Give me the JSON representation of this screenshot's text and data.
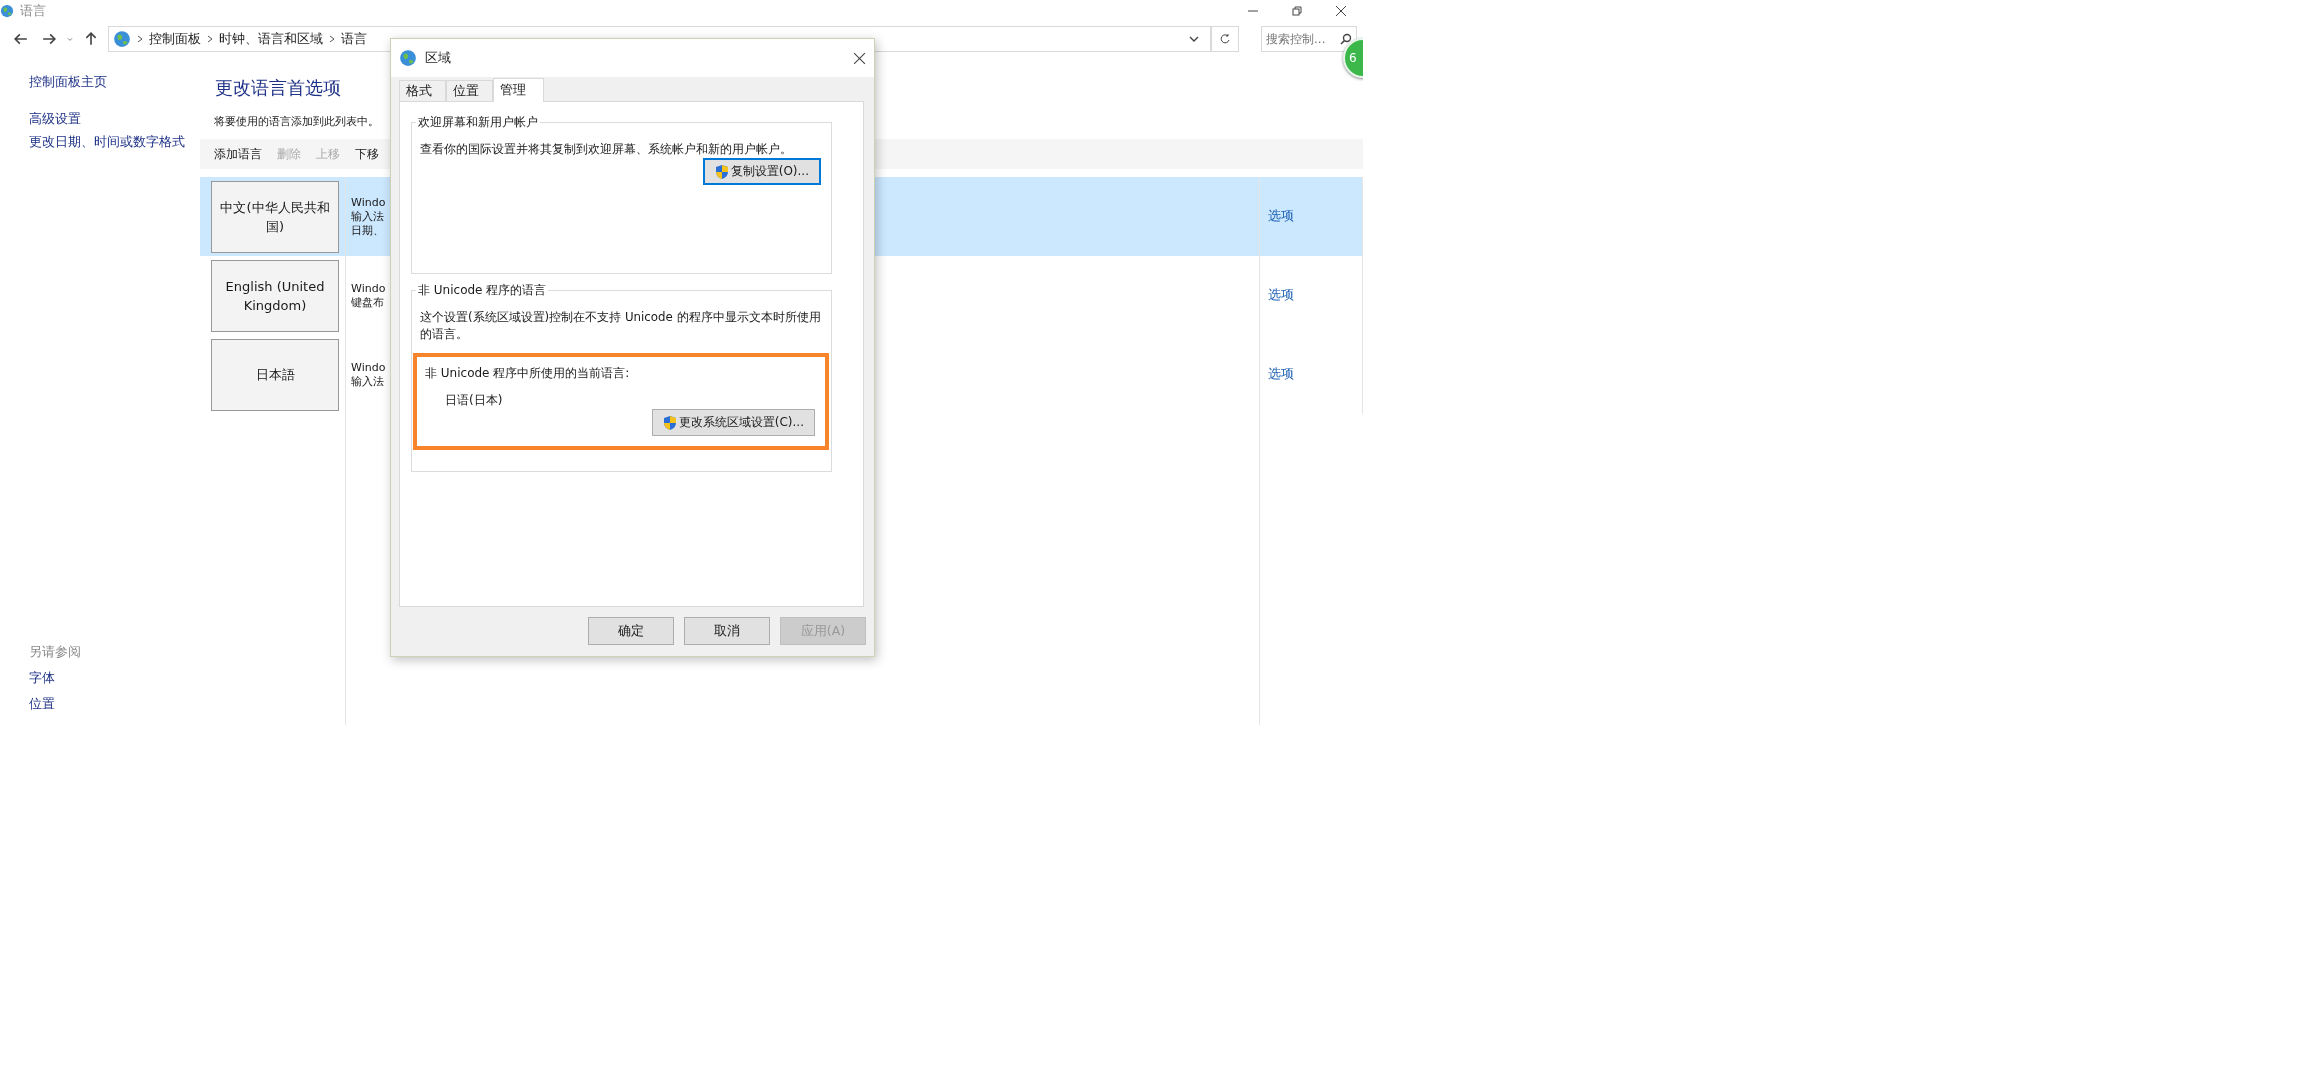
{
  "window": {
    "title": "语言"
  },
  "address_bar": {
    "breadcrumbs": [
      "控制面板",
      "时钟、语言和区域",
      "语言"
    ]
  },
  "search": {
    "placeholder": "搜索控制..."
  },
  "badge": {
    "text": "6"
  },
  "sidebar": {
    "items": [
      {
        "label": "控制面板主页"
      },
      {
        "label": "高级设置"
      },
      {
        "label": "更改日期、时间或数字格式"
      }
    ],
    "see_also": {
      "title": "另请参阅",
      "items": [
        "字体",
        "位置"
      ]
    }
  },
  "main": {
    "heading": "更改语言首选项",
    "description": "将要使用的语言添加到此列表中。",
    "toolbar": [
      {
        "label": "添加语言",
        "disabled": false
      },
      {
        "label": "删除",
        "disabled": true
      },
      {
        "label": "上移",
        "disabled": true
      },
      {
        "label": "下移",
        "disabled": false
      }
    ],
    "languages": [
      {
        "name": "中文(中华人民共和国)",
        "details": [
          "Windo",
          "输入法",
          "日期、"
        ],
        "options": "选项",
        "selected": true
      },
      {
        "name": "English (United Kingdom)",
        "details": [
          "Windo",
          "键盘布"
        ],
        "options": "选项",
        "selected": false
      },
      {
        "name": "日本語",
        "details": [
          "Windo",
          "输入法"
        ],
        "options": "选项",
        "selected": false
      }
    ]
  },
  "dialog": {
    "title": "区域",
    "tabs": [
      {
        "label": "格式",
        "selected": false
      },
      {
        "label": "位置",
        "selected": false
      },
      {
        "label": "管理",
        "selected": true
      }
    ],
    "groups": [
      {
        "title": "欢迎屏幕和新用户帐户",
        "text": "查看你的国际设置并将其复制到欢迎屏幕、系统帐户和新的用户帐户。",
        "button": {
          "label": "复制设置(O)...",
          "default": true
        }
      },
      {
        "title": "非 Unicode 程序的语言",
        "text": "这个设置(系统区域设置)控制在不支持 Unicode 的程序中显示文本时所使用的语言。",
        "highlight": {
          "label": "非 Unicode 程序中所使用的当前语言:",
          "value": "日语(日本)",
          "button": {
            "label": "更改系统区域设置(C)...",
            "default": false
          }
        }
      }
    ],
    "buttons": [
      {
        "label": "确定",
        "disabled": false
      },
      {
        "label": "取消",
        "disabled": false
      },
      {
        "label": "应用(A)",
        "disabled": true
      }
    ]
  }
}
